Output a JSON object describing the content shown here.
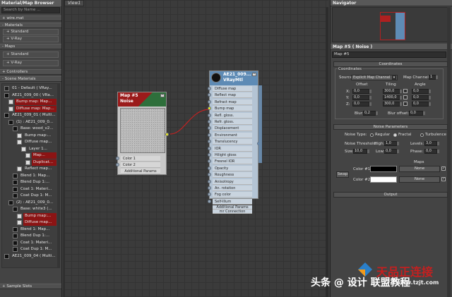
{
  "browser": {
    "title": "Material/Map Browser",
    "search_placeholder": "Search by Name ...",
    "wire_mat": "+ wire.mat",
    "materials_label": "- Materials",
    "standard_label": "+ Standard",
    "vray_label": "+ V-Ray",
    "maps_label": "- Maps",
    "maps_standard": "+ Standard",
    "maps_vray": "+ V-Ray",
    "controllers": "+ Controllers",
    "scene_materials": "- Scene Materials",
    "sample_slots": "+ Sample Slots",
    "tree": [
      {
        "label": "01 - Default  ( VRay...",
        "indent": 0,
        "swatch": "#222222",
        "style": "normal"
      },
      {
        "label": "AE21_009_00  ( VRa...",
        "indent": 0,
        "swatch": "#111111",
        "style": "normal"
      },
      {
        "label": "Bump map: Map...",
        "indent": 1,
        "swatch": "#dddddd",
        "style": "red"
      },
      {
        "label": "Diffuse map: Map...",
        "indent": 1,
        "swatch": "#dddddd",
        "style": "red"
      },
      {
        "label": "AE21_009_01  ( Multi...",
        "indent": 0,
        "swatch": "#111111",
        "style": "normal"
      },
      {
        "label": "(1) : AE21_009_0...",
        "indent": 1,
        "swatch": "#111111",
        "style": "normal"
      },
      {
        "label": "Base: wood_v2...",
        "indent": 2,
        "swatch": "#111111",
        "style": "normal"
      },
      {
        "label": "Bump map:...",
        "indent": 3,
        "swatch": "#dddddd",
        "style": "normal"
      },
      {
        "label": "Diffuse map...",
        "indent": 3,
        "swatch": "#dddddd",
        "style": "normal"
      },
      {
        "label": "Layer 1...",
        "indent": 4,
        "swatch": "#dddddd",
        "style": "normal"
      },
      {
        "label": "Map...",
        "indent": 5,
        "swatch": "#dddddd",
        "style": "red"
      },
      {
        "label": "Duplicat...",
        "indent": 5,
        "swatch": "#dddddd",
        "style": "red"
      },
      {
        "label": "Reflect map...",
        "indent": 3,
        "swatch": "#dddddd",
        "style": "normal"
      },
      {
        "label": "Blend 1: Map...",
        "indent": 2,
        "swatch": "#111111",
        "style": "normal"
      },
      {
        "label": "Blend Dup 1:...",
        "indent": 2,
        "swatch": "#111111",
        "style": "normal"
      },
      {
        "label": "Coat 1: Materi...",
        "indent": 2,
        "swatch": "#111111",
        "style": "normal"
      },
      {
        "label": "Coat Dup 1: M...",
        "indent": 2,
        "swatch": "#111111",
        "style": "normal"
      },
      {
        "label": "(2) : AE21_009_0...",
        "indent": 1,
        "swatch": "#111111",
        "style": "normal"
      },
      {
        "label": "Base: white3  (...",
        "indent": 2,
        "swatch": "#111111",
        "style": "normal"
      },
      {
        "label": "Bump map:...",
        "indent": 3,
        "swatch": "#dddddd",
        "style": "red"
      },
      {
        "label": "Diffuse map...",
        "indent": 3,
        "swatch": "#dddddd",
        "style": "red"
      },
      {
        "label": "Blend 1: Map...",
        "indent": 2,
        "swatch": "#111111",
        "style": "normal"
      },
      {
        "label": "Blend Dup 1:...",
        "indent": 2,
        "swatch": "#111111",
        "style": "normal"
      },
      {
        "label": "Coat 1: Materi...",
        "indent": 2,
        "swatch": "#111111",
        "style": "normal"
      },
      {
        "label": "Coat Dup 1: M...",
        "indent": 2,
        "swatch": "#111111",
        "style": "normal"
      },
      {
        "label": "AE21_009_04  ( Multi...",
        "indent": 0,
        "swatch": "#111111",
        "style": "normal"
      }
    ]
  },
  "viewport": {
    "tab": "View1",
    "noise_node": {
      "title_line1": "Map #5",
      "title_line2": "Noise",
      "slots": [
        "Color 1",
        "Color 2"
      ],
      "footer": "Additional Params"
    },
    "vray_node": {
      "title_line1": "AE21_009...",
      "title_line2": "VRayMtl",
      "slots": [
        "Diffuse map",
        "Reflect map",
        "Refract map",
        "Bump map",
        "Refl. gloss.",
        "Refr. gloss.",
        "Displacement",
        "Environment",
        "Translucency",
        "IOR",
        "Hilight gloss",
        "Fresnel IOR",
        "Opacity",
        "Roughness",
        "Anisotropy",
        "An. rotation",
        "Fog color",
        "Self-Illum"
      ],
      "footer1": "Additional Params",
      "footer2": "mr Connection"
    }
  },
  "navigator": {
    "title": "Navigator"
  },
  "params": {
    "header": "Map #5  ( Noise )",
    "map_name": "Map #5",
    "coords_roll": "Coordinates",
    "coords_group": "Coordinates",
    "source_label": "Source:",
    "source_value": "Explicit Map Channel",
    "map_channel_label": "Map Channel:",
    "map_channel_value": "1",
    "col_offset": "Offset",
    "col_tiling": "Tiling",
    "col_angle": "Angle",
    "rows": [
      {
        "axis": "X:",
        "offset": "0,0",
        "tiling": "300,0",
        "angle": "0,0"
      },
      {
        "axis": "Y:",
        "offset": "0,0",
        "tiling": "1400,0",
        "angle": "0,0"
      },
      {
        "axis": "Z:",
        "offset": "0,0",
        "tiling": "300,0",
        "angle": "0,0"
      }
    ],
    "blur_label": "Blur:",
    "blur_value": "0,2",
    "blur_offset_label": "Blur offset:",
    "blur_offset_value": "0,0",
    "noise_roll": "Noise Parameters",
    "noise_type_label": "Noise Type:",
    "noise_types": [
      "Regular",
      "Fractal",
      "Turbulence"
    ],
    "noise_type_selected": "Fractal",
    "noise_threshold_label": "Noise Threshold:",
    "high_label": "High:",
    "high_value": "1,0",
    "levels_label": "Levels:",
    "levels_value": "3,0",
    "size_label": "Size:",
    "size_value": "10,0",
    "low_label": "Low:",
    "low_value": "0,0",
    "phase_label": "Phase:",
    "phase_value": "0,0",
    "maps_label": "Maps",
    "swap_label": "Swap",
    "color1_label": "Color #1",
    "color2_label": "Color #2",
    "color1": "#000000",
    "color2": "#ffffff",
    "none1": "None",
    "none2": "None",
    "output_roll": "Output"
  },
  "watermark": {
    "text": "头条 @ 设计 联盟教程",
    "logo_text": "天品正连接",
    "logo_sub": "www.tzjt.com"
  }
}
